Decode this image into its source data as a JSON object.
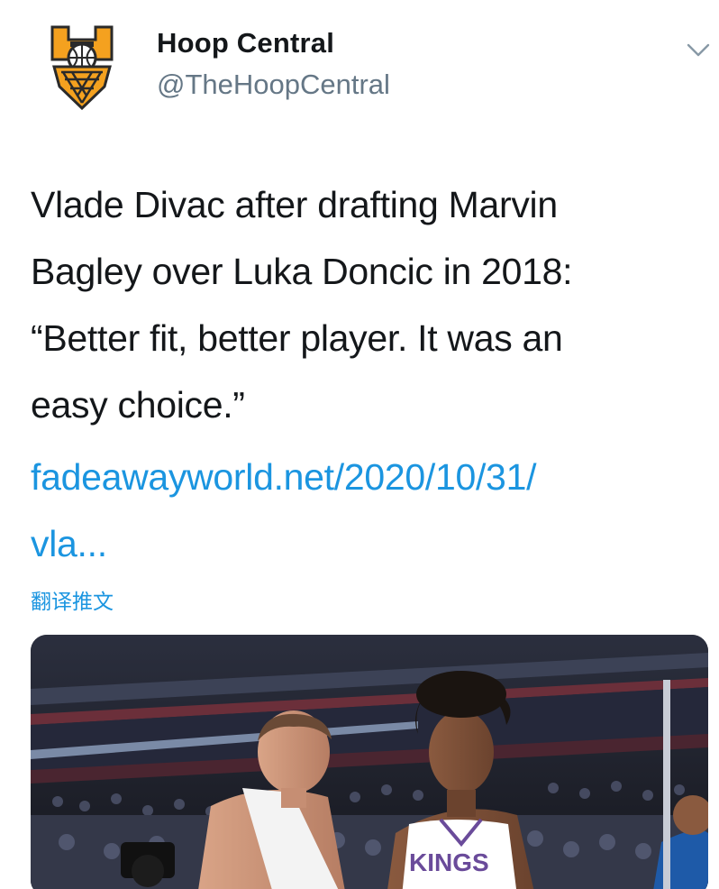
{
  "author": {
    "name": "Hoop Central",
    "handle": "@TheHoopCentral",
    "avatar_icon": "hoop-central-logo",
    "brand_colors": {
      "orange": "#f4a11f",
      "dark": "#2a2a2a"
    }
  },
  "menu": {
    "icon": "chevron-down-icon"
  },
  "tweet": {
    "text_lines": [
      "Vlade Divac after drafting Marvin",
      "Bagley over Luka Doncic in 2018:",
      "“Better fit, better player. It was an",
      "easy choice.”"
    ],
    "link_lines": [
      "fadeawayworld.net/2020/10/31/",
      "vla..."
    ],
    "link_color": "#1b95e0",
    "translate_label": "翻译推文"
  },
  "media": {
    "jersey_text": "KINGS"
  }
}
